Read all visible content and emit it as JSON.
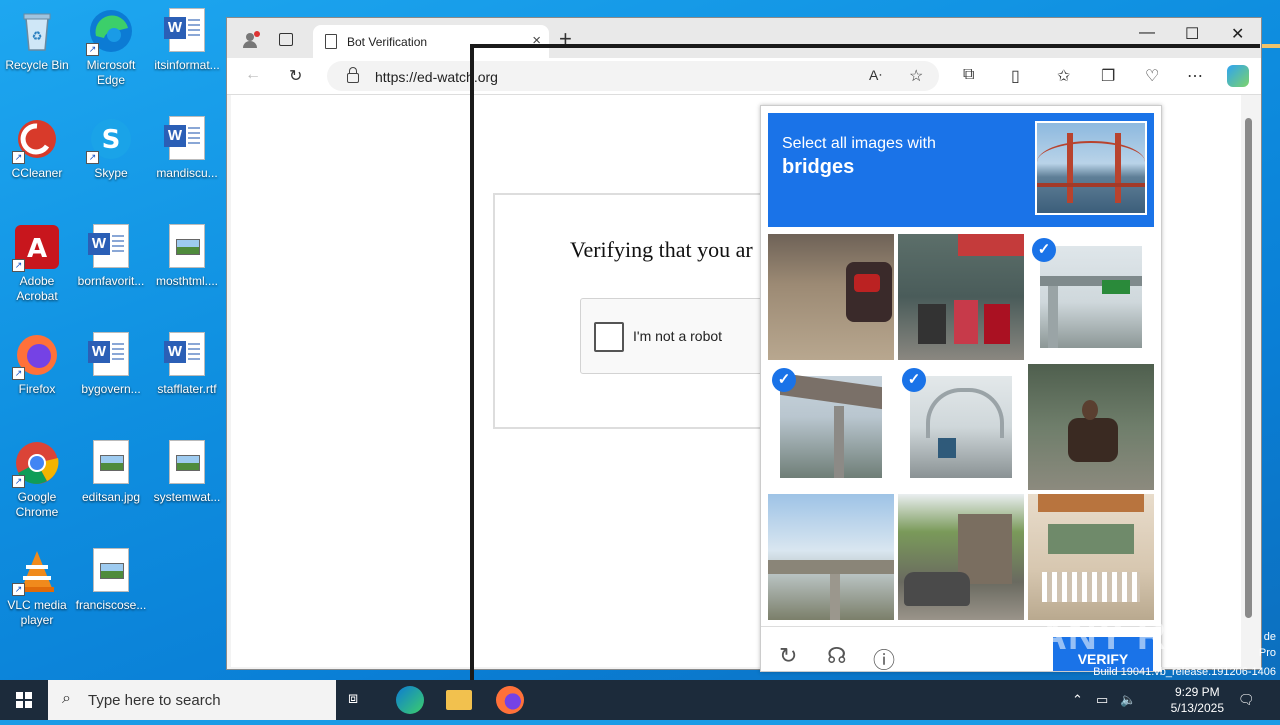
{
  "desktop": {
    "icons": [
      {
        "label": "Recycle Bin"
      },
      {
        "label": "Microsoft Edge"
      },
      {
        "label": "itsinformat..."
      },
      {
        "label": "CCleaner"
      },
      {
        "label": "Skype"
      },
      {
        "label": "mandiscu..."
      },
      {
        "label": "Adobe Acrobat"
      },
      {
        "label": "bornfavorit..."
      },
      {
        "label": "mosthtml...."
      },
      {
        "label": "Firefox"
      },
      {
        "label": "bygovern..."
      },
      {
        "label": "stafflater.rtf"
      },
      {
        "label": "Google Chrome"
      },
      {
        "label": "editsan.jpg"
      },
      {
        "label": "systemwat..."
      },
      {
        "label": "VLC media player"
      },
      {
        "label": "franciscose..."
      }
    ],
    "watermark": "ANY RUN",
    "build_info": "Build 19041.vb_release.191206-1406",
    "build_partial_1": "de",
    "build_partial_2": "Pro"
  },
  "browser": {
    "tab_title": "Bot Verification",
    "url": "https://ed-watch.org",
    "new_tab_symbol": "+",
    "tab_close_symbol": "×",
    "window_controls": {
      "minimize": "—",
      "maximize": "☐",
      "close": "✕"
    }
  },
  "page": {
    "verify_heading": "Verifying that you ar",
    "checkbox_label": "I'm not a robot"
  },
  "captcha": {
    "prompt_prefix": "Select all images with",
    "prompt_keyword": "bridges",
    "tiles": [
      {
        "name": "scooter-dirt",
        "selected": false
      },
      {
        "name": "scooters-shopfront",
        "selected": false
      },
      {
        "name": "highway-overpass-sign",
        "selected": true
      },
      {
        "name": "overpass-underside",
        "selected": true
      },
      {
        "name": "arch-bridge-truck",
        "selected": true
      },
      {
        "name": "motorcycle-doorway",
        "selected": false
      },
      {
        "name": "overpass-sky",
        "selected": false
      },
      {
        "name": "car-street-house",
        "selected": false
      },
      {
        "name": "house-balcony",
        "selected": false
      }
    ],
    "verify_label": "VERIFY",
    "colors": {
      "accent": "#1a73e8"
    }
  },
  "taskbar": {
    "search_placeholder": "Type here to search",
    "time": "9:29 PM",
    "date": "5/13/2025"
  }
}
